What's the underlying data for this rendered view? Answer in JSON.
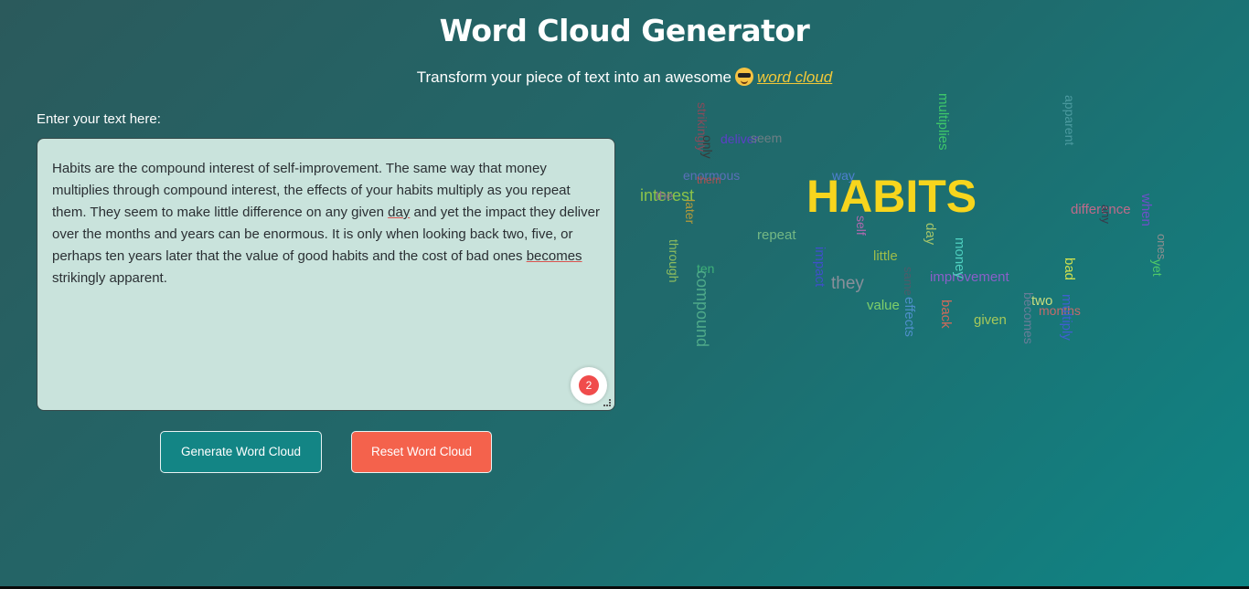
{
  "header": {
    "title": "Word Cloud Generator",
    "subtitle_prefix": "Transform your piece of text into an awesome",
    "subtitle_link": "word cloud"
  },
  "input": {
    "label": "Enter your text here:",
    "text_p1": "Habits are the compound interest of self-improvement. The same way that money multiplies through compound interest, the effects of your habits multiply as you repeat them. They seem to make little difference on any given ",
    "text_u1": "day",
    "text_p2": " and yet the impact they deliver over the months and years can be enormous. It is only when looking back two, five, or perhaps ten years later that the value of good habits and the cost of bad ones ",
    "text_u2": "becomes",
    "text_p3": " strikingly apparent.",
    "error_count": "2"
  },
  "buttons": {
    "generate": "Generate Word Cloud",
    "reset": "Reset Word Cloud"
  },
  "colors": {
    "accent": "#138585",
    "reset": "#f4624c",
    "highlight": "#f2c838",
    "textbox_bg": "#c9e3dc"
  },
  "cloud_words": [
    {
      "text": "HABITS",
      "color": "#f7d51d"
    },
    {
      "text": "interest",
      "color": "#8bc34a"
    },
    {
      "text": "the",
      "color": "#8e6b86"
    },
    {
      "text": "deliver",
      "color": "#5c3fc7"
    },
    {
      "text": "seem",
      "color": "#6e7e84"
    },
    {
      "text": "enormous",
      "color": "#5b6fb8"
    },
    {
      "text": "them",
      "color": "#b04f4f"
    },
    {
      "text": "way",
      "color": "#4f7fd0"
    },
    {
      "text": "difference",
      "color": "#c06a8a"
    },
    {
      "text": "repeat",
      "color": "#74b884"
    },
    {
      "text": "little",
      "color": "#9dbc4a"
    },
    {
      "text": "they",
      "color": "#8a8f9a"
    },
    {
      "text": "improvement",
      "color": "#8b5fc9"
    },
    {
      "text": "value",
      "color": "#7fcf6a"
    },
    {
      "text": "given",
      "color": "#a7c95a"
    },
    {
      "text": "two",
      "color": "#c9dc7e"
    },
    {
      "text": "months",
      "color": "#c46b6b"
    },
    {
      "text": "ten",
      "color": "#3fb078"
    },
    {
      "text": "strikingly",
      "color": "#8a4a5a"
    },
    {
      "text": "only",
      "color": "#3a3a3a"
    },
    {
      "text": "multiplies",
      "color": "#3ec76a"
    },
    {
      "text": "apparent",
      "color": "#4d9ba0"
    },
    {
      "text": "later",
      "color": "#b39a3a"
    },
    {
      "text": "through",
      "color": "#8dbc5f"
    },
    {
      "text": "compound",
      "color": "#4faa8a"
    },
    {
      "text": "impact",
      "color": "#3f4fc9"
    },
    {
      "text": "self",
      "color": "#b069b0"
    },
    {
      "text": "day",
      "color": "#a3c46a"
    },
    {
      "text": "money",
      "color": "#4fd0c0"
    },
    {
      "text": "same",
      "color": "#4e5b6a"
    },
    {
      "text": "effects",
      "color": "#4e8fc9"
    },
    {
      "text": "back",
      "color": "#d06a5a"
    },
    {
      "text": "becomes",
      "color": "#6a7d99"
    },
    {
      "text": "multiply",
      "color": "#3f5fd0"
    },
    {
      "text": "bad",
      "color": "#cfe04f"
    },
    {
      "text": "when",
      "color": "#6f4fc9"
    },
    {
      "text": "ones",
      "color": "#8f8f8f"
    },
    {
      "text": "yet",
      "color": "#4fc968"
    },
    {
      "text": "any",
      "color": "#3a3a4a"
    }
  ]
}
